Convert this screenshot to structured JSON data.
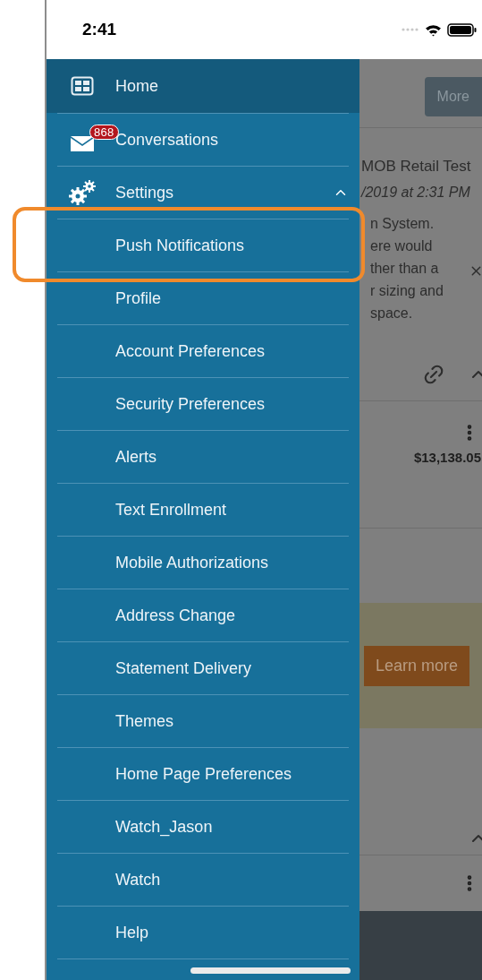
{
  "status_bar": {
    "time": "2:41"
  },
  "menu": [
    {
      "kind": "dashboard",
      "label": "Home",
      "selected": true
    },
    {
      "kind": "mail",
      "label": "Conversations",
      "badge": "868",
      "selected": false
    },
    {
      "kind": "group",
      "label": "Settings",
      "selected": false,
      "expanded": true,
      "children": [
        {
          "label": "Push Notifications",
          "selected": false
        },
        {
          "label": "Profile",
          "selected": false
        },
        {
          "label": "Account Preferences",
          "selected": false
        },
        {
          "label": "Security Preferences",
          "selected": false
        },
        {
          "label": "Alerts",
          "selected": false
        },
        {
          "label": "Text Enrollment",
          "selected": false
        },
        {
          "label": "Mobile Authorizations",
          "selected": false
        },
        {
          "label": "Address Change",
          "selected": false
        },
        {
          "label": "Statement Delivery",
          "selected": false
        },
        {
          "label": "Themes",
          "selected": false
        },
        {
          "label": "Home Page Preferences",
          "selected": false
        },
        {
          "label": "Watch_Jason",
          "selected": false
        },
        {
          "label": "Watch",
          "selected": false
        },
        {
          "label": "Help",
          "selected": false
        }
      ]
    }
  ],
  "background": {
    "more_button": "More",
    "title": "MOB Retail Test",
    "date": "/2019 at 2:31 PM",
    "message_lines": [
      "n System.",
      "ere would",
      "ther than a",
      "r sizing and",
      "space."
    ],
    "amount": "$13,138.05",
    "learn_more": "Learn more"
  }
}
